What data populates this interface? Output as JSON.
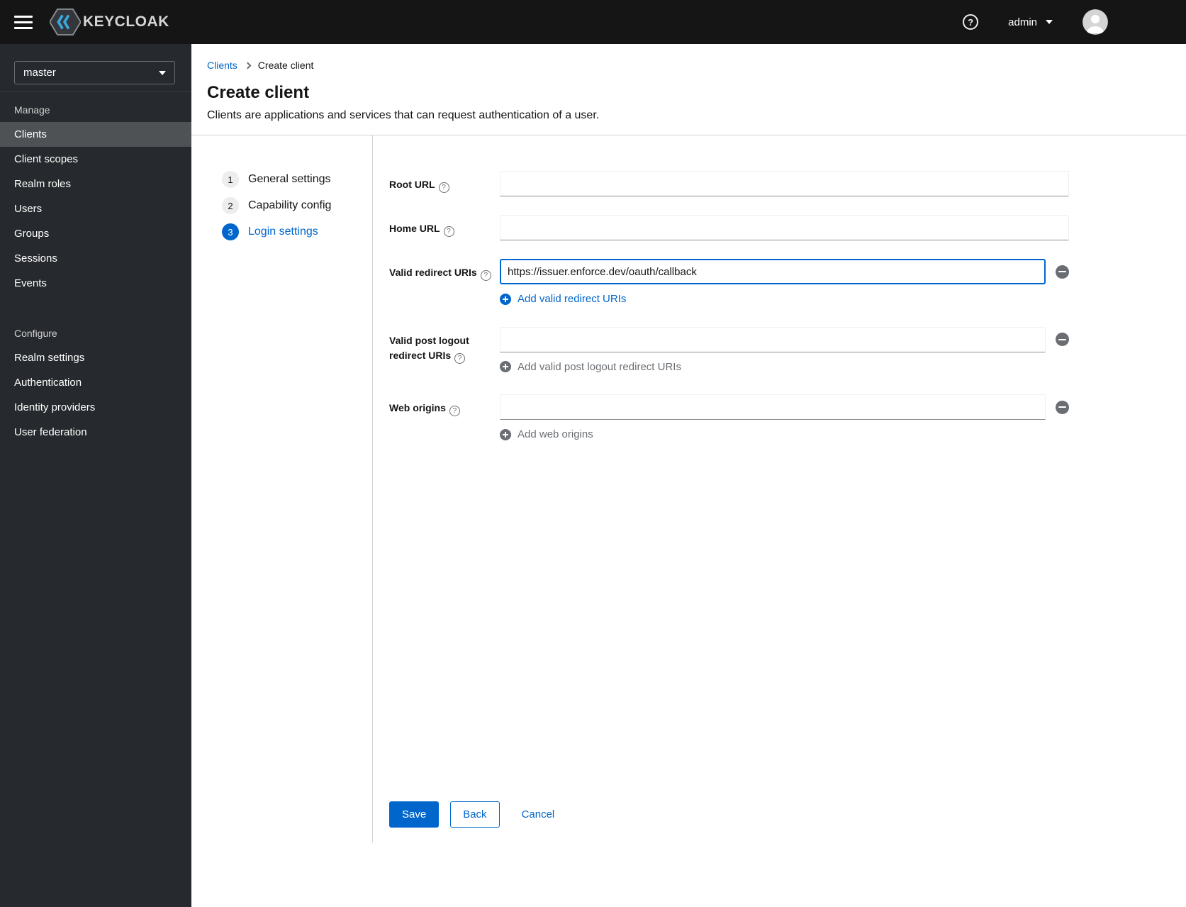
{
  "colors": {
    "accent": "#0066cc",
    "header_bg": "#151515",
    "sidebar_bg": "#26292d",
    "sidebar_selected": "#4f5255",
    "divider": "#d2d2d2"
  },
  "icons": {
    "help": "?"
  },
  "header": {
    "brand": "KEYCLOAK",
    "username": "admin"
  },
  "sidebar": {
    "realm": "master",
    "manage_label": "Manage",
    "manage_items": [
      "Clients",
      "Client scopes",
      "Realm roles",
      "Users",
      "Groups",
      "Sessions",
      "Events"
    ],
    "selected_item": "Clients",
    "configure_label": "Configure",
    "configure_items": [
      "Realm settings",
      "Authentication",
      "Identity providers",
      "User federation"
    ]
  },
  "breadcrumb": {
    "parent": "Clients",
    "current": "Create client"
  },
  "page": {
    "title": "Create client",
    "subtitle": "Clients are applications and services that can request authentication of a user."
  },
  "wizard": {
    "active_step": "Login settings",
    "steps": [
      {
        "num": "1",
        "label": "General settings"
      },
      {
        "num": "2",
        "label": "Capability config"
      },
      {
        "num": "3",
        "label": "Login settings"
      }
    ]
  },
  "form": {
    "root_url": {
      "label": "Root URL",
      "value": ""
    },
    "home_url": {
      "label": "Home URL",
      "value": ""
    },
    "redirect_uris": {
      "label": "Valid redirect URIs",
      "value": "https://issuer.enforce.dev/oauth/callback",
      "add_label": "Add valid redirect URIs"
    },
    "post_logout_uris": {
      "label": "Valid post logout redirect URIs",
      "value": "",
      "add_label": "Add valid post logout redirect URIs"
    },
    "web_origins": {
      "label": "Web origins",
      "value": "",
      "add_label": "Add web origins"
    }
  },
  "actions": {
    "save": "Save",
    "back": "Back",
    "cancel": "Cancel"
  }
}
